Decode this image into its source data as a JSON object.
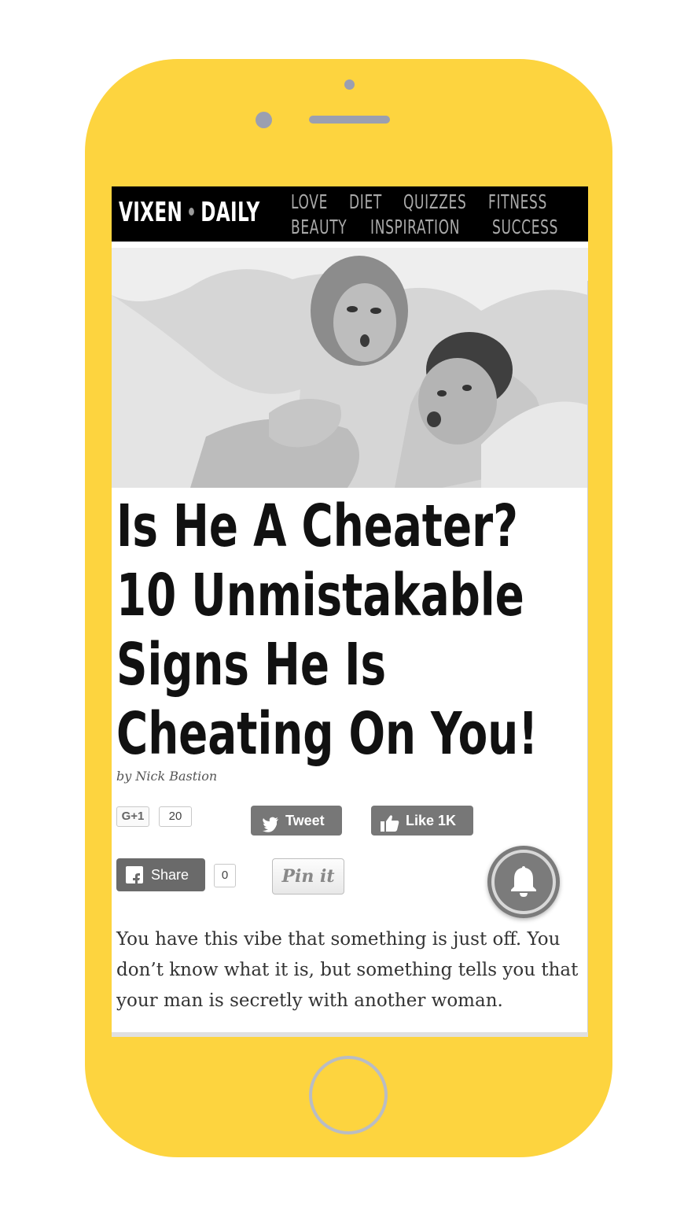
{
  "site": {
    "logo_left": "VIXEN",
    "logo_right": "DAILY"
  },
  "nav": {
    "row1": [
      "LOVE",
      "DIET",
      "QUIZZES",
      "FITNESS"
    ],
    "row2": [
      "BEAUTY",
      "INSPIRATION",
      "SUCCESS"
    ]
  },
  "article": {
    "headline": "Is He A Cheater? 10 Unmistakable Signs He Is Cheating On You!",
    "byline": "by  Nick Bastion",
    "body": "You have this vibe that something is just off. You don’t know what it is, but something tells you that your man is secretly with another woman."
  },
  "social": {
    "gplus_label": "G+1",
    "gplus_count": "20",
    "tweet_label": "Tweet",
    "like_label": "Like 1K",
    "share_label": "Share",
    "share_count": "0",
    "pin_label": "Pin it"
  },
  "icons": {
    "bell": "notification-bell-icon",
    "twitter": "twitter-bird-icon",
    "facebook": "facebook-icon",
    "thumbs_up": "thumbs-up-icon"
  },
  "colors": {
    "phone_body": "#fdd43f",
    "phone_accents": "#9b9fb0",
    "nav_background": "#000000",
    "nav_text": "#aaaaaa"
  }
}
